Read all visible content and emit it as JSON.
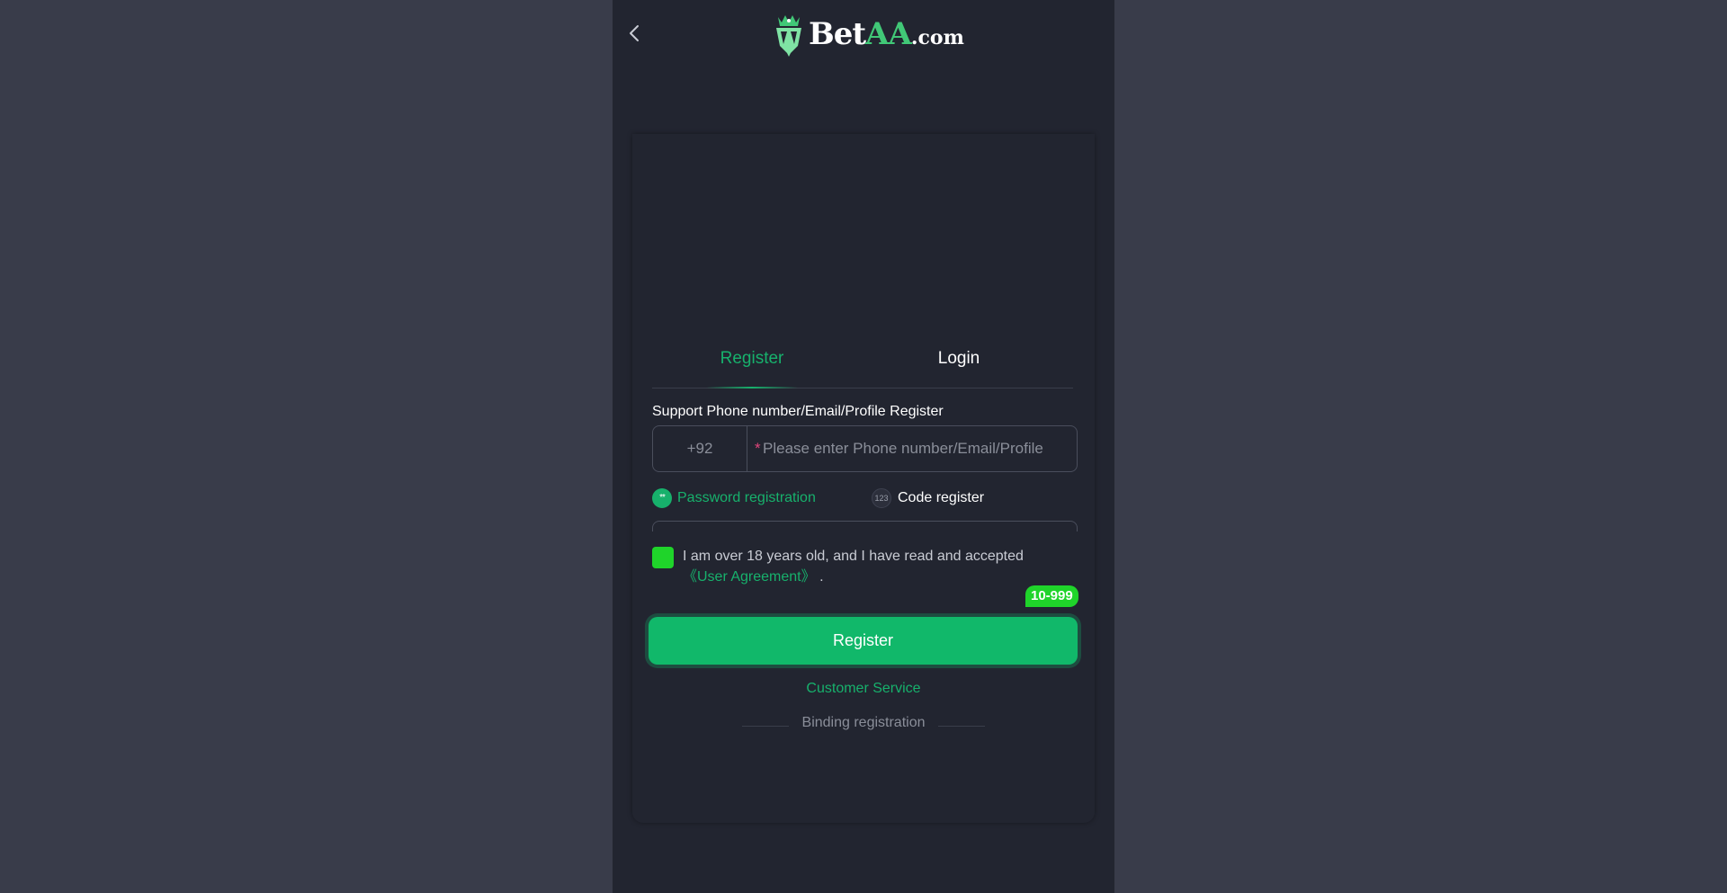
{
  "brand": {
    "logo_prefix": "Bet",
    "logo_highlight": "AA",
    "logo_suffix": ".com",
    "accent_color": "#17b16c",
    "checkbox_color": "#1fd42a"
  },
  "header": {
    "back_icon": "chevron-left-icon"
  },
  "tabs": [
    {
      "label": "Register",
      "active": true
    },
    {
      "label": "Login",
      "active": false
    }
  ],
  "form": {
    "support_label": "Support Phone number/Email/Profile Register",
    "country_code": "+92",
    "required_mark": "*",
    "account_placeholder": "Please enter Phone number/Email/Profile",
    "methods": [
      {
        "label": "Password registration",
        "icon_text": "**",
        "selected": true
      },
      {
        "label": "Code register",
        "icon_text": "123",
        "selected": false
      }
    ],
    "agreement": {
      "checked": true,
      "text": "I am over 18 years old, and I have read and accepted",
      "link": "《User Agreement》",
      "end": "."
    },
    "bonus_badge": "10-999",
    "submit_label": "Register",
    "customer_service": "Customer Service",
    "binding": "Binding registration"
  }
}
